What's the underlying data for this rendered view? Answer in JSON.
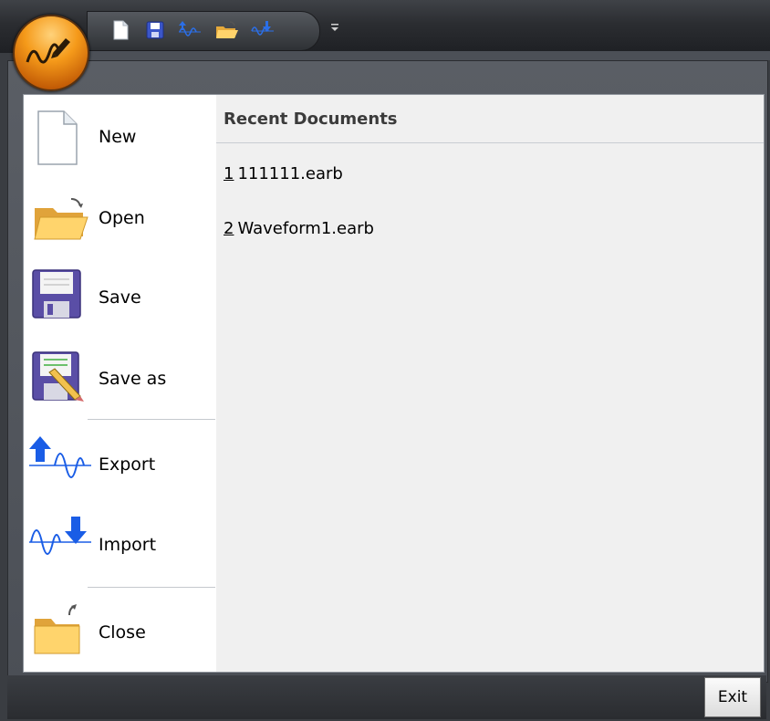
{
  "app": {
    "logo_icon": "waveform-pen-icon"
  },
  "quick_access": {
    "items": [
      {
        "name": "new-icon"
      },
      {
        "name": "save-icon"
      },
      {
        "name": "export-icon"
      },
      {
        "name": "open-icon"
      },
      {
        "name": "import-icon"
      }
    ],
    "overflow_icon": "customize-dropdown-icon"
  },
  "menu": {
    "items": [
      {
        "label": "New",
        "icon": "new-document-icon"
      },
      {
        "label": "Open",
        "icon": "open-folder-icon"
      },
      {
        "label": "Save",
        "icon": "floppy-disk-icon"
      },
      {
        "label": "Save as",
        "icon": "save-as-icon"
      },
      {
        "label": "Export",
        "icon": "export-waveform-icon"
      },
      {
        "label": "Import",
        "icon": "import-waveform-icon"
      },
      {
        "label": "Close",
        "icon": "close-folder-icon"
      }
    ]
  },
  "recent": {
    "header": "Recent Documents",
    "items": [
      {
        "num": "1",
        "name": "111111.earb"
      },
      {
        "num": "2",
        "name": "Waveform1.earb"
      }
    ]
  },
  "exit_label": "Exit",
  "colors": {
    "orb": "#f59a1a",
    "accent_blue": "#1a4fd8",
    "folder": "#f5c35a"
  }
}
